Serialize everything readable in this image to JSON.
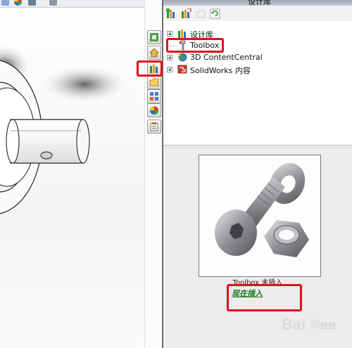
{
  "panel": {
    "title": "设计库",
    "tree_items": [
      {
        "label": "设计库",
        "icon": "design-library-icon"
      },
      {
        "label": "Toolbox",
        "icon": "toolbox-icon"
      },
      {
        "label": "3D ContentCentral",
        "icon": "globe-icon"
      },
      {
        "label": "SolidWorks 内容",
        "icon": "solidworks-content-icon"
      }
    ],
    "toolbar_icons": [
      "add-to-library-icon",
      "add-file-location-icon",
      "create-folder-icon",
      "refresh-icon"
    ]
  },
  "preview": {
    "caption": "Toolbox 未插入",
    "insert_link": "现在插入"
  },
  "task_pane_tabs": [
    "solidworks-resources-icon",
    "home-icon",
    "design-library-icon",
    "file-explorer-icon",
    "view-palette-icon",
    "appearances-icon",
    "custom-properties-icon"
  ],
  "watermark": {
    "text": "经验"
  },
  "colors": {
    "highlight": "#e0101c",
    "link": "#1a7a1a"
  }
}
